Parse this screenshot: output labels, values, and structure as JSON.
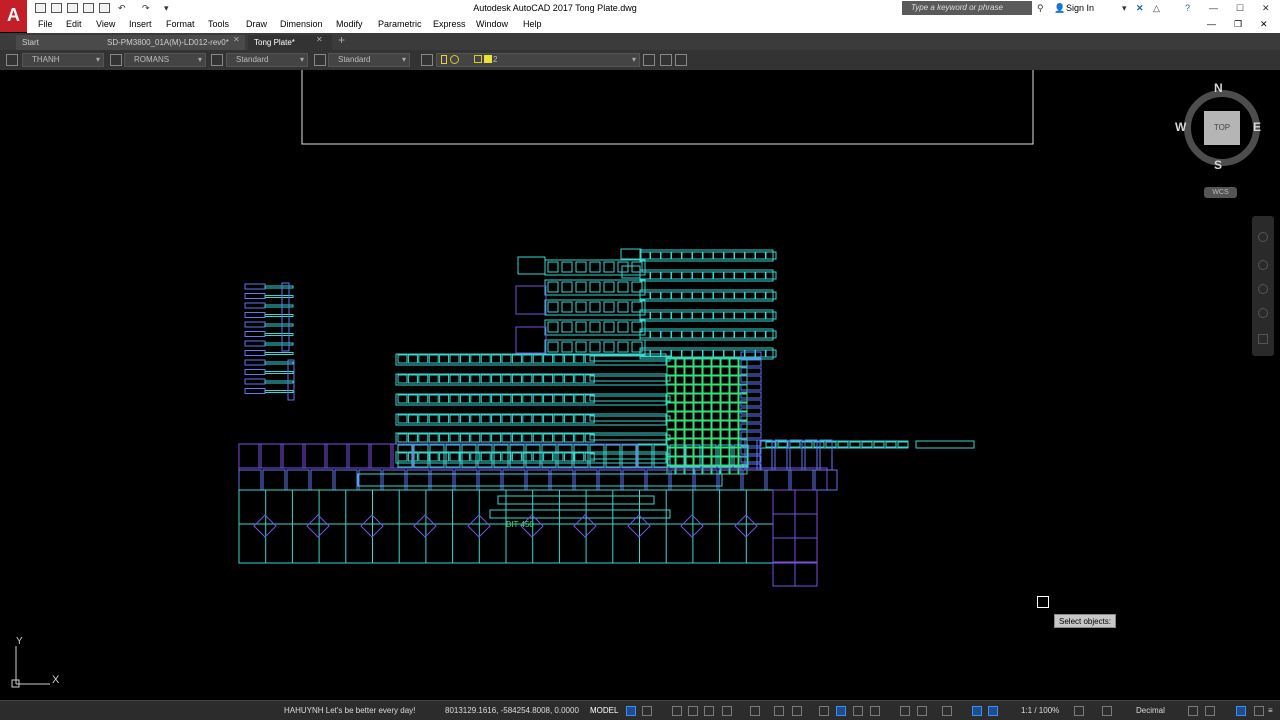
{
  "app": {
    "logo": "A",
    "title": "Autodesk AutoCAD 2017   Tong Plate.dwg",
    "search_placeholder": "Type a keyword or phrase",
    "sign_in": "Sign In"
  },
  "menu": [
    "File",
    "Edit",
    "View",
    "Insert",
    "Format",
    "Tools",
    "Draw",
    "Dimension",
    "Modify",
    "Parametric",
    "Express",
    "Window",
    "Help"
  ],
  "tabs": [
    {
      "label": "Start",
      "active": false
    },
    {
      "label": "SD-PM3800_01A(M)-LD012-rev0*",
      "active": false
    },
    {
      "label": "Tong Plate*",
      "active": true
    }
  ],
  "toolbar": {
    "text_style": "THANH",
    "font": "ROMANS",
    "dim_style": "Standard",
    "table_style": "Standard",
    "layer": "2"
  },
  "viewcube": {
    "north": "N",
    "south": "S",
    "east": "E",
    "west": "W",
    "face": "TOP",
    "wcs": "WCS"
  },
  "ucs": {
    "x": "X",
    "y": "Y"
  },
  "drawing": {
    "annotation": "BIT 450"
  },
  "prompt": "Select objects:",
  "status": {
    "message": "HAHUYNH Let's be better every day!",
    "coordinates": "8013129.1616, -584254.8008, 0.0000",
    "model": "MODEL",
    "scale": "1:1 / 100%",
    "units": "Decimal"
  },
  "colors": {
    "cyan": "#3ad6d0",
    "green": "#38e07a",
    "purple": "#7a4fe0",
    "blue": "#5f79f0",
    "accent": "#c41f28"
  }
}
